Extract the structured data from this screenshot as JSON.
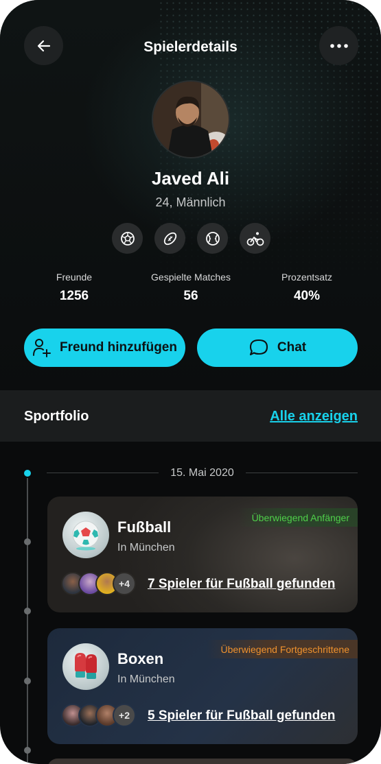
{
  "header": {
    "title": "Spielerdetails"
  },
  "profile": {
    "name": "Javed Ali",
    "subtitle": "24, Männlich",
    "sports": [
      "football-icon",
      "rugby-icon",
      "baseball-icon",
      "cycling-icon"
    ]
  },
  "stats": [
    {
      "label": "Freunde",
      "value": "1256"
    },
    {
      "label": "Gespielte Matches",
      "value": "56"
    },
    {
      "label": "Prozentsatz",
      "value": "40%"
    }
  ],
  "actions": {
    "add_friend": "Freund hinzufügen",
    "chat": "Chat"
  },
  "portfolio": {
    "title": "Sportfolio",
    "see_all": "Alle anzeigen",
    "date": "15. Mai 2020",
    "cards": [
      {
        "sport": "Fußball",
        "location": "In München",
        "level": "Überwiegend Anfänger",
        "level_color": "#4fd04a",
        "more_players": "+4",
        "players_link": "7 Spieler für Fußball gefunden"
      },
      {
        "sport": "Boxen",
        "location": "In München",
        "level": "Überwiegend Fortgeschrittene",
        "level_color": "#f0922e",
        "more_players": "+2",
        "players_link": "5 Spieler für Fußball gefunden"
      }
    ]
  },
  "colors": {
    "accent": "#18d2ec",
    "background": "#0a0b0c"
  }
}
